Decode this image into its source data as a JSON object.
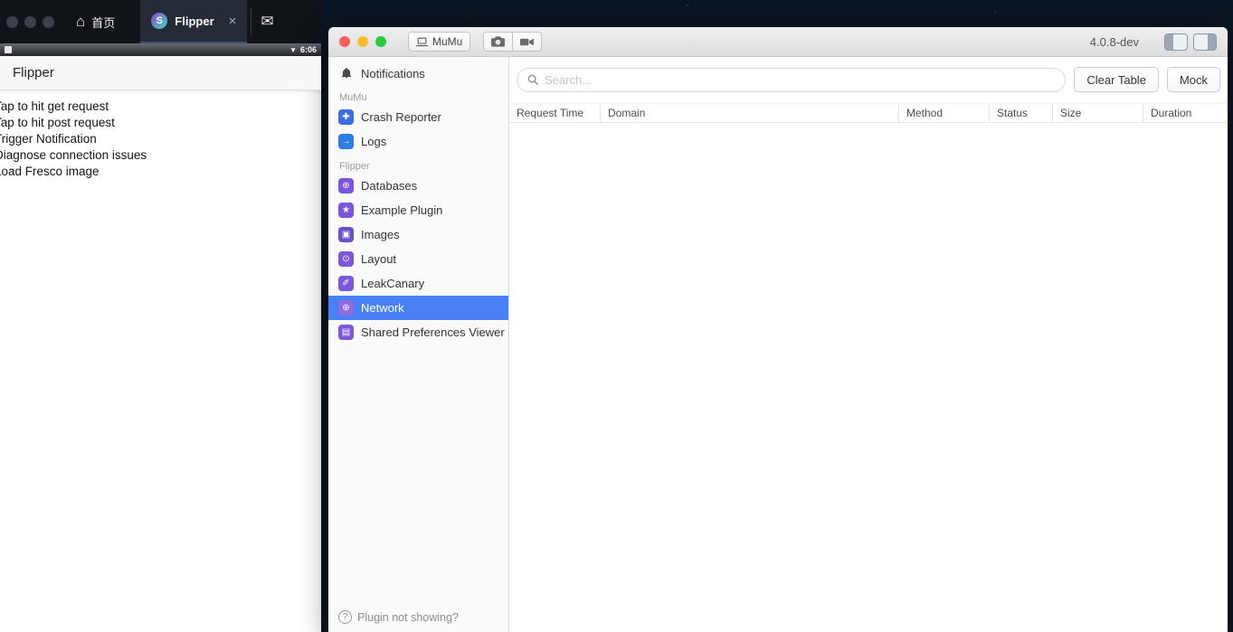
{
  "emulator": {
    "tabbar": {
      "home_label": "首页",
      "tab_label": "Flipper",
      "close_label": "×",
      "mail_glyph": "✉",
      "home_glyph": "⌂"
    },
    "statusbar": {
      "time": "6:06",
      "signal_glyph": "▼"
    },
    "appbar_title": "Flipper",
    "list_items": [
      "Tap to hit get request",
      "Tap to hit post request",
      "Trigger Notification",
      "Diagnose connection issues",
      "Load Fresco image"
    ]
  },
  "window": {
    "traffic_lights": {
      "close": "#ff5f57",
      "minimize": "#febc2e",
      "zoom": "#28c840"
    },
    "device_button_label": "MuMu",
    "version": "4.0.8-dev"
  },
  "sidebar": {
    "notifications_label": "Notifications",
    "selection_color": "#4a80f5",
    "sections": [
      {
        "title": "MuMu",
        "items": [
          {
            "label": "Crash Reporter",
            "color": "#3b6fe0",
            "glyph": "✚"
          },
          {
            "label": "Logs",
            "color": "#2e7de4",
            "glyph": "→"
          }
        ]
      },
      {
        "title": "Flipper",
        "items": [
          {
            "label": "Databases",
            "color": "#7d57d9",
            "glyph": "⊕"
          },
          {
            "label": "Example Plugin",
            "color": "#7d57d9",
            "glyph": "★"
          },
          {
            "label": "Images",
            "color": "#6a4fc4",
            "glyph": "▣"
          },
          {
            "label": "Layout",
            "color": "#7d57d9",
            "glyph": "⊙"
          },
          {
            "label": "LeakCanary",
            "color": "#7d57d9",
            "glyph": "✐"
          },
          {
            "label": "Network",
            "color": "#8e6be0",
            "glyph": "⊕"
          },
          {
            "label": "Shared Preferences Viewer",
            "color": "#7d57d9",
            "glyph": "▤"
          }
        ]
      }
    ],
    "footer_label": "Plugin not showing?",
    "footer_icon_glyph": "?"
  },
  "main": {
    "search_placeholder": "Search...",
    "clear_table_label": "Clear Table",
    "mock_label": "Mock",
    "table_headers": [
      "Request Time",
      "Domain",
      "Method",
      "Status",
      "Size",
      "Duration"
    ]
  }
}
